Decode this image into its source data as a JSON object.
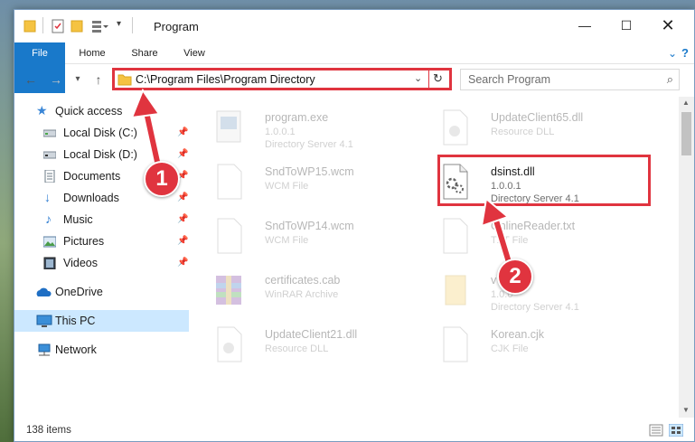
{
  "window": {
    "title": "Program"
  },
  "ribbon": {
    "tabs": [
      "File",
      "Home",
      "Share",
      "View"
    ]
  },
  "address": {
    "path": "C:\\Program Files\\Program Directory"
  },
  "search": {
    "placeholder": "Search Program"
  },
  "sidebar": {
    "items": [
      {
        "label": "Quick access",
        "icon": "star-icon"
      },
      {
        "label": "Local Disk (C:)",
        "icon": "drive-icon",
        "pinned": true
      },
      {
        "label": "Local Disk (D:)",
        "icon": "drive-icon",
        "pinned": true
      },
      {
        "label": "Documents",
        "icon": "documents-icon",
        "pinned": true
      },
      {
        "label": "Downloads",
        "icon": "downloads-icon",
        "pinned": true
      },
      {
        "label": "Music",
        "icon": "music-icon",
        "pinned": true
      },
      {
        "label": "Pictures",
        "icon": "pictures-icon",
        "pinned": true
      },
      {
        "label": "Videos",
        "icon": "videos-icon",
        "pinned": true
      },
      {
        "label": "OneDrive",
        "icon": "onedrive-icon"
      },
      {
        "label": "This PC",
        "icon": "pc-icon",
        "selected": true
      },
      {
        "label": "Network",
        "icon": "network-icon"
      }
    ]
  },
  "files": [
    {
      "name": "program.exe",
      "line1": "1.0.0.1",
      "line2": "Directory Server 4.1",
      "icon": "exe-icon"
    },
    {
      "name": "UpdateClient65.dll",
      "line1": "Resource DLL",
      "line2": "",
      "icon": "dll-icon"
    },
    {
      "name": "SndToWP15.wcm",
      "line1": "WCM File",
      "line2": "",
      "icon": "file-icon"
    },
    {
      "name": "dsinst.dll",
      "line1": "1.0.0.1",
      "line2": "Directory Server 4.1",
      "icon": "dll-icon"
    },
    {
      "name": "SndToWP14.wcm",
      "line1": "WCM File",
      "line2": "",
      "icon": "file-icon"
    },
    {
      "name": "OnlineReader.txt",
      "line1": "TXT File",
      "line2": "",
      "icon": "file-icon"
    },
    {
      "name": "certificates.cab",
      "line1": "WinRAR Archive",
      "line2": "",
      "icon": "archive-icon"
    },
    {
      "name": "v",
      "line1": "1.0.0",
      "line2": "Directory Server 4.1",
      "icon": "folder-file-icon"
    },
    {
      "name": "UpdateClient21.dll",
      "line1": "Resource DLL",
      "line2": "",
      "icon": "dll-icon"
    },
    {
      "name": "Korean.cjk",
      "line1": "CJK File",
      "line2": "",
      "icon": "file-icon"
    }
  ],
  "status": {
    "count": "138 items"
  },
  "annotations": {
    "badge1": "1",
    "badge2": "2"
  },
  "colors": {
    "accent": "#1979ca",
    "highlight": "#e0343f",
    "selection": "#cce8ff"
  }
}
